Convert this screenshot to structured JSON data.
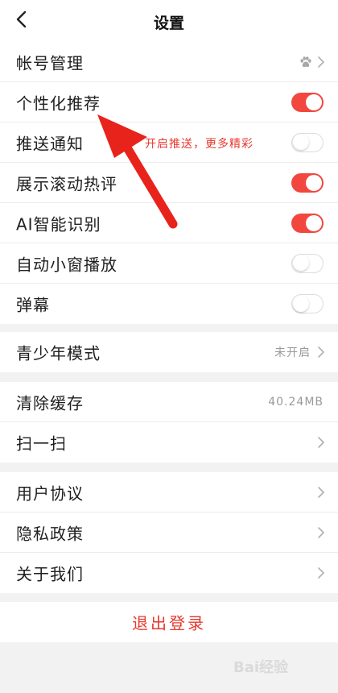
{
  "header": {
    "title": "设置",
    "back_icon": "chevron-left-icon"
  },
  "groups": [
    {
      "rows": [
        {
          "label": "帐号管理",
          "type": "link",
          "icon": "paw-icon"
        },
        {
          "label": "个性化推荐",
          "type": "toggle",
          "on": true
        },
        {
          "label": "推送通知",
          "type": "toggle",
          "on": false
        },
        {
          "label": "展示滚动热评",
          "type": "toggle",
          "on": true
        },
        {
          "label": "AI智能识别",
          "type": "toggle",
          "on": true
        },
        {
          "label": "自动小窗播放",
          "type": "toggle",
          "on": false
        },
        {
          "label": "弹幕",
          "type": "toggle",
          "on": false
        }
      ]
    },
    {
      "rows": [
        {
          "label": "青少年模式",
          "type": "link",
          "value": "未开启"
        }
      ]
    },
    {
      "rows": [
        {
          "label": "清除缓存",
          "type": "value",
          "value": "40.24MB"
        },
        {
          "label": "扫一扫",
          "type": "link"
        }
      ]
    },
    {
      "rows": [
        {
          "label": "用户协议",
          "type": "link"
        },
        {
          "label": "隐私政策",
          "type": "link"
        },
        {
          "label": "关于我们",
          "type": "link"
        }
      ]
    }
  ],
  "annotation": {
    "text": "开启推送，更多精彩",
    "color": "#e8382f"
  },
  "logout": {
    "label": "退出登录"
  },
  "colors": {
    "accent": "#f2473e",
    "toggle_off_border": "#dcdcdc",
    "background": "#f2f2f2"
  },
  "watermark": {
    "text": "Bai经验"
  }
}
